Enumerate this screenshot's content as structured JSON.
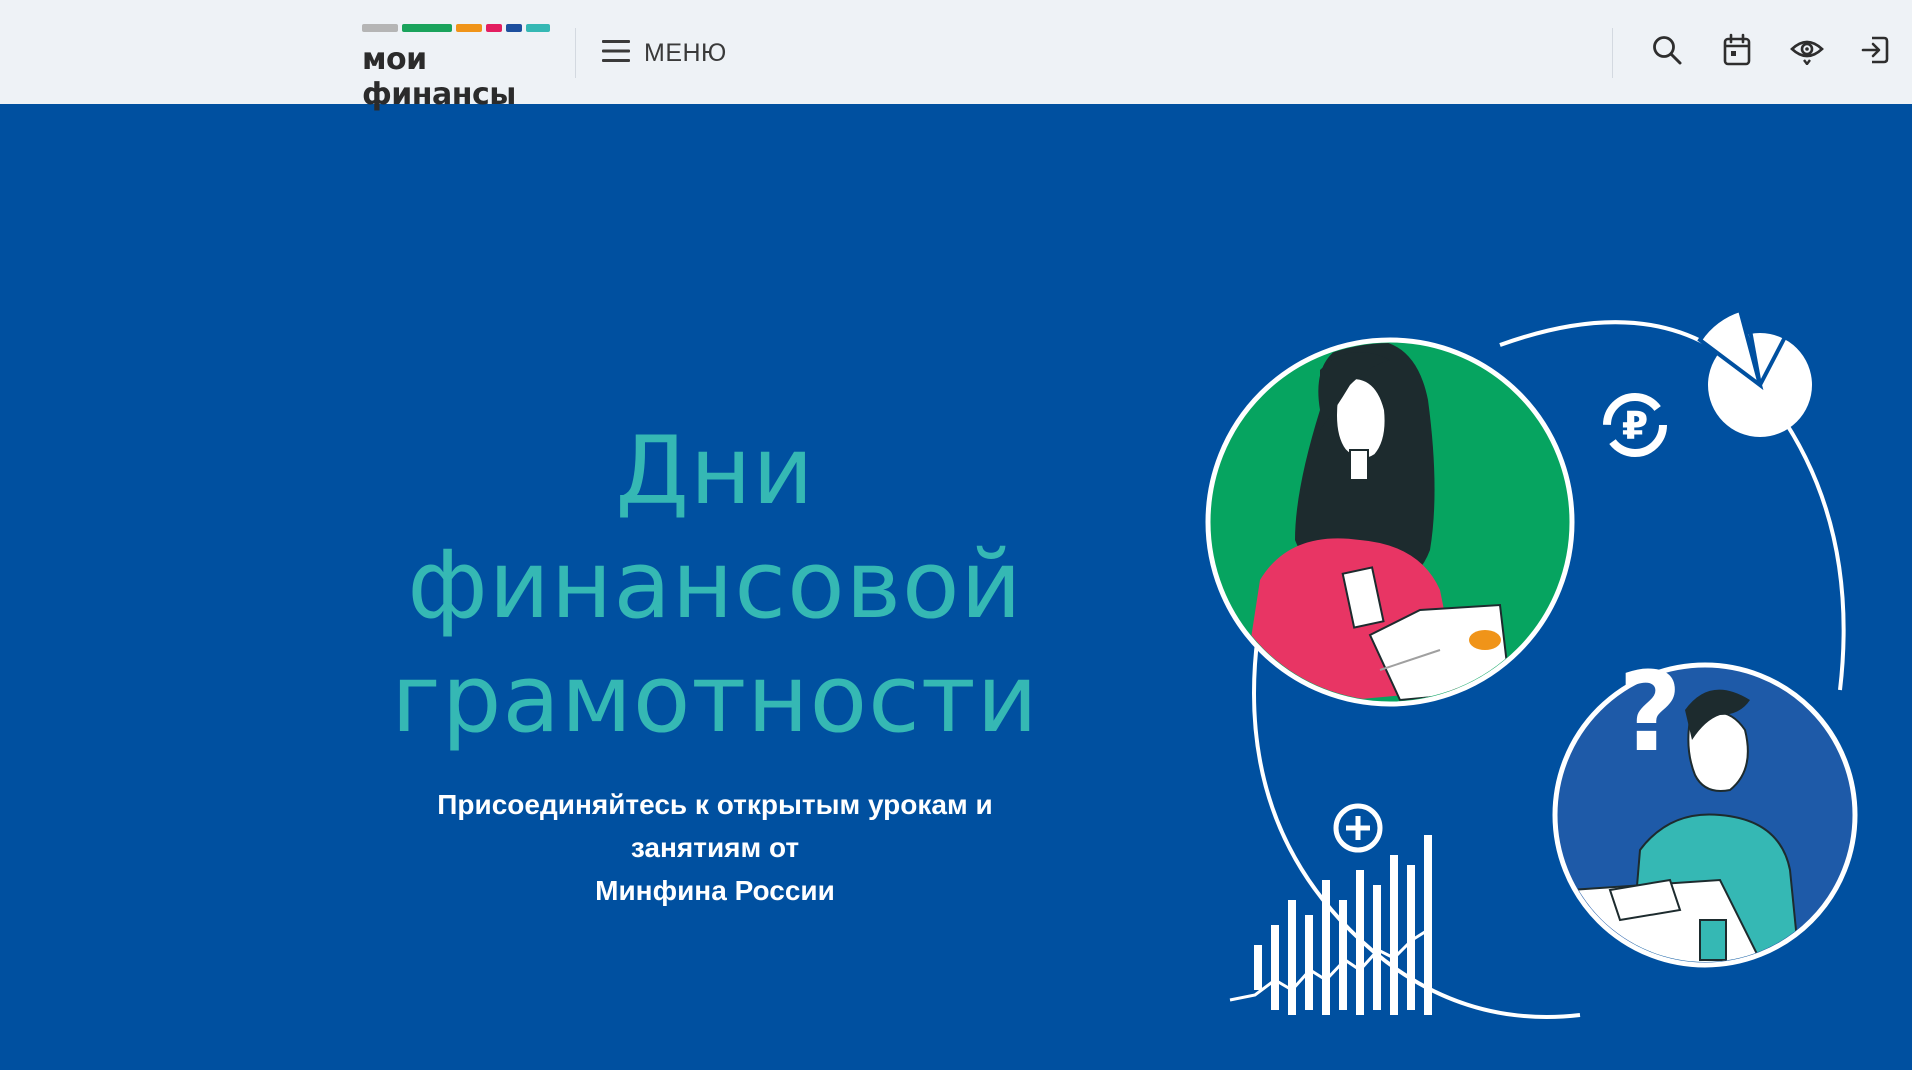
{
  "header": {
    "logo_text": "мои финансы",
    "logo_colors": [
      "#b5b5b5",
      "#1aa35c",
      "#f09419",
      "#e31e60",
      "#1d4f9e",
      "#35b8b4"
    ],
    "menu_label": "МЕНЮ",
    "tools": [
      "search-icon",
      "calendar-icon",
      "accessibility-eye-icon",
      "login-icon"
    ]
  },
  "hero": {
    "title_lines": [
      "Дни",
      "финансовой",
      "грамотности"
    ],
    "subtitle_lines": [
      "Присоединяйтесь к открытым урокам и занятиям от",
      "Минфина России"
    ]
  },
  "colors": {
    "background": "#0050a0",
    "topbar": "#eef2f6",
    "title": "#35b8b4",
    "green_circle": "#06a460",
    "blue_circle": "#1e5aa8"
  }
}
